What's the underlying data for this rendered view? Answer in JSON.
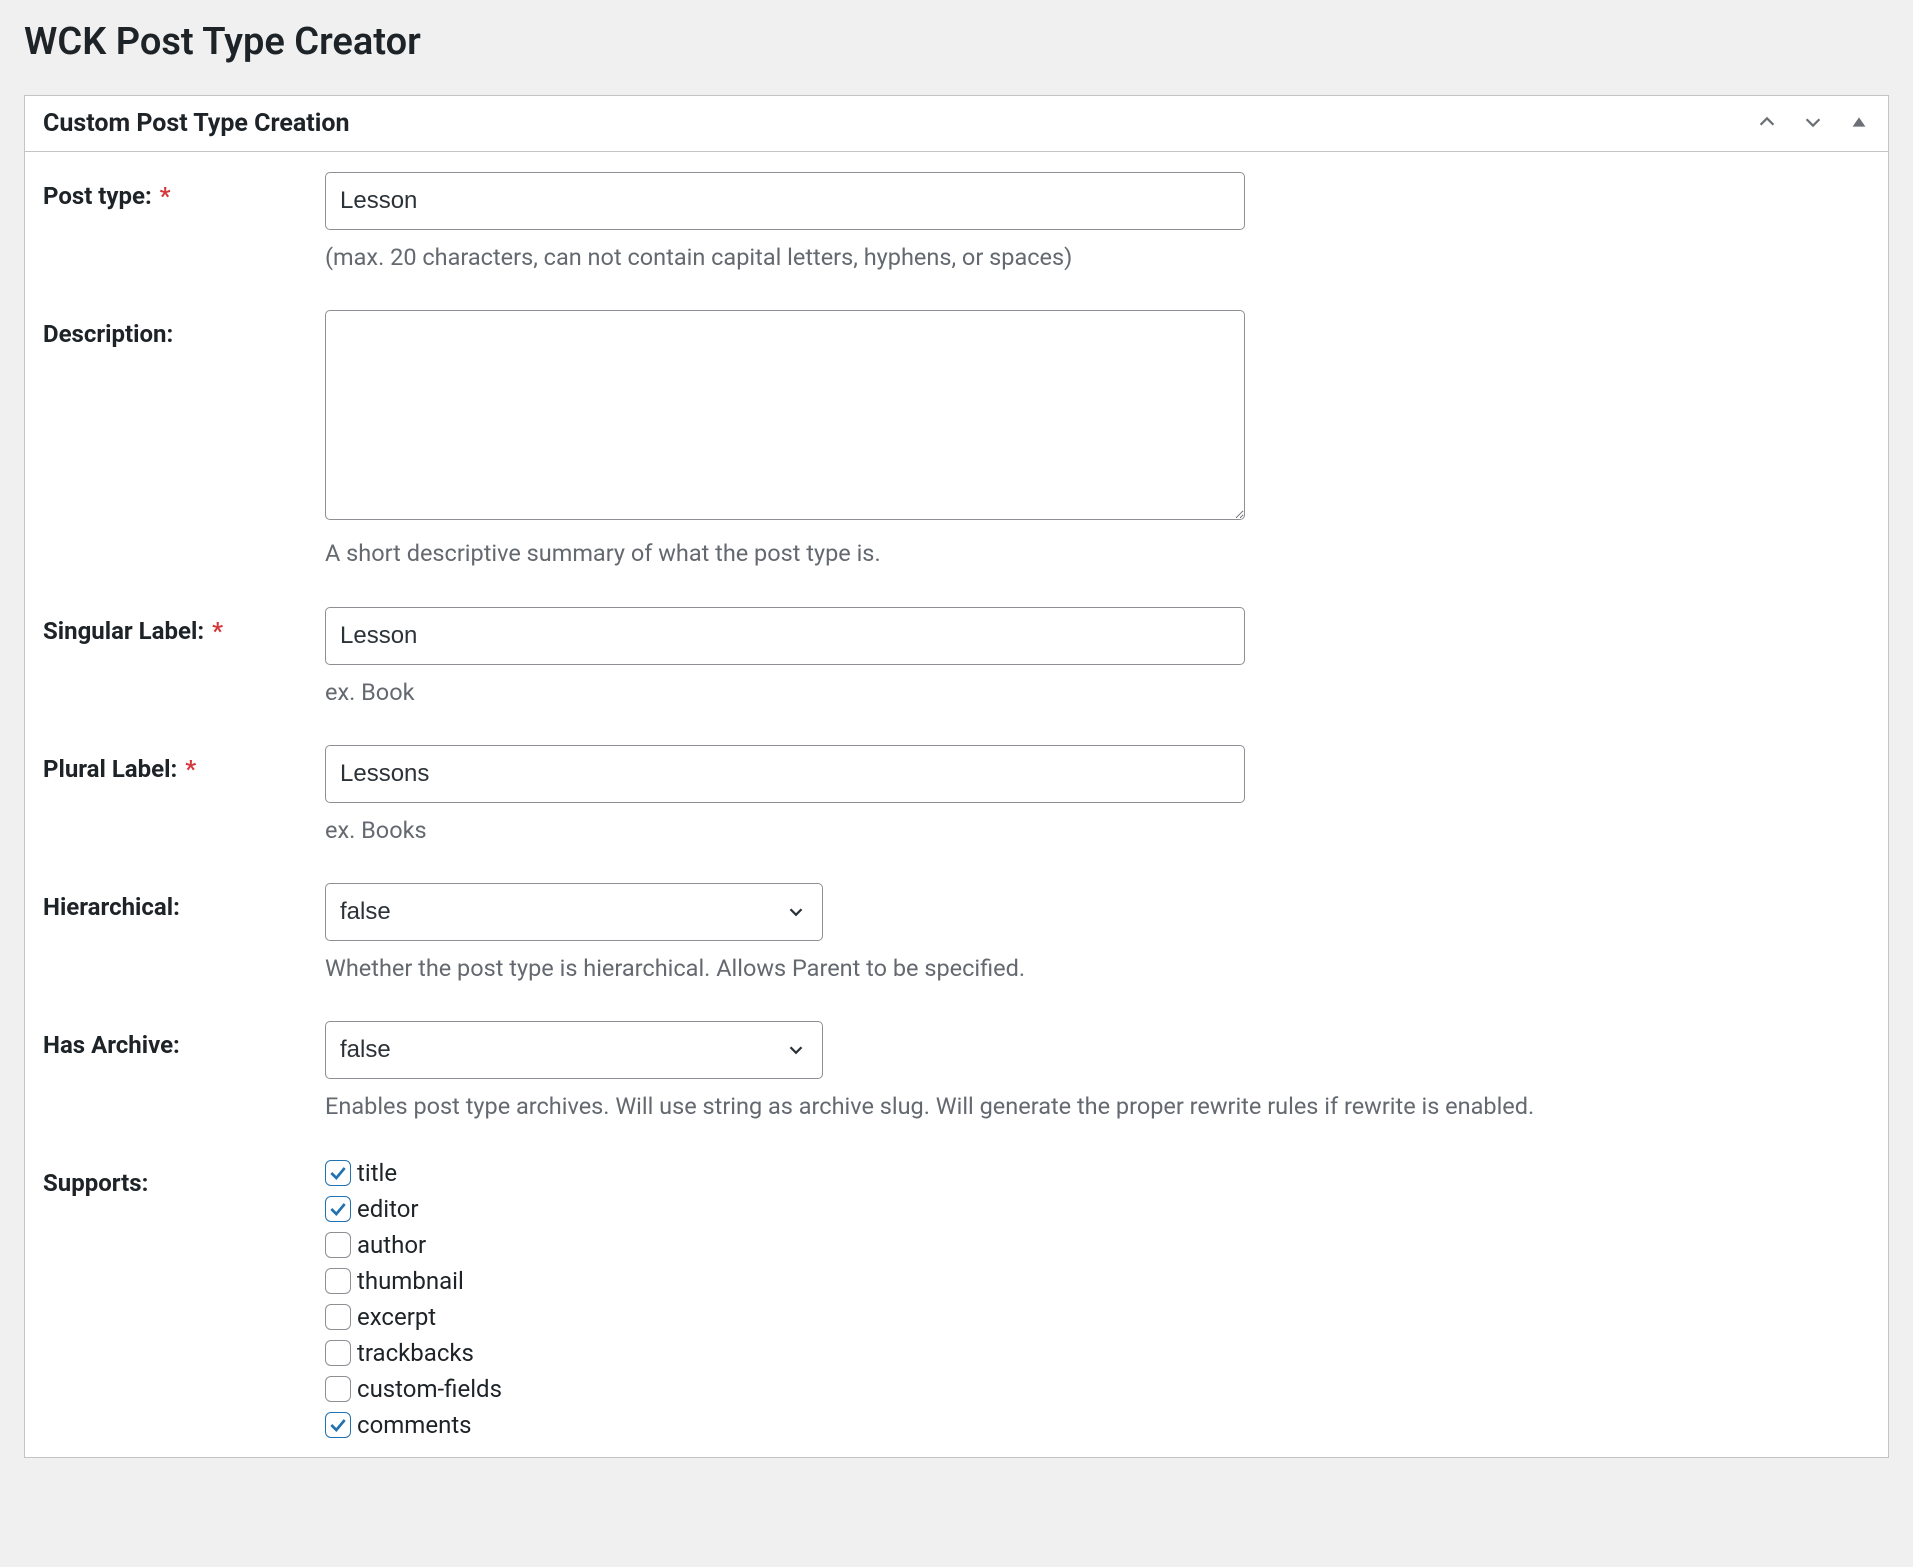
{
  "page": {
    "title": "WCK Post Type Creator"
  },
  "panel": {
    "title": "Custom Post Type Creation"
  },
  "fields": {
    "post_type": {
      "label": "Post type:",
      "required": true,
      "value": "Lesson",
      "help": "(max. 20 characters, can not contain capital letters, hyphens, or spaces)"
    },
    "description": {
      "label": "Description:",
      "required": false,
      "value": "",
      "help": "A short descriptive summary of what the post type is."
    },
    "singular_label": {
      "label": "Singular Label:",
      "required": true,
      "value": "Lesson",
      "help": "ex. Book"
    },
    "plural_label": {
      "label": "Plural Label:",
      "required": true,
      "value": "Lessons",
      "help": "ex. Books"
    },
    "hierarchical": {
      "label": "Hierarchical:",
      "required": false,
      "value": "false",
      "help": "Whether the post type is hierarchical. Allows Parent to be specified."
    },
    "has_archive": {
      "label": "Has Archive:",
      "required": false,
      "value": "false",
      "help": "Enables post type archives. Will use string as archive slug. Will generate the proper rewrite rules if rewrite is enabled."
    },
    "supports": {
      "label": "Supports:",
      "items": [
        {
          "name": "title",
          "checked": true
        },
        {
          "name": "editor",
          "checked": true
        },
        {
          "name": "author",
          "checked": false
        },
        {
          "name": "thumbnail",
          "checked": false
        },
        {
          "name": "excerpt",
          "checked": false
        },
        {
          "name": "trackbacks",
          "checked": false
        },
        {
          "name": "custom-fields",
          "checked": false
        },
        {
          "name": "comments",
          "checked": true
        }
      ]
    }
  },
  "required_marker": "*"
}
